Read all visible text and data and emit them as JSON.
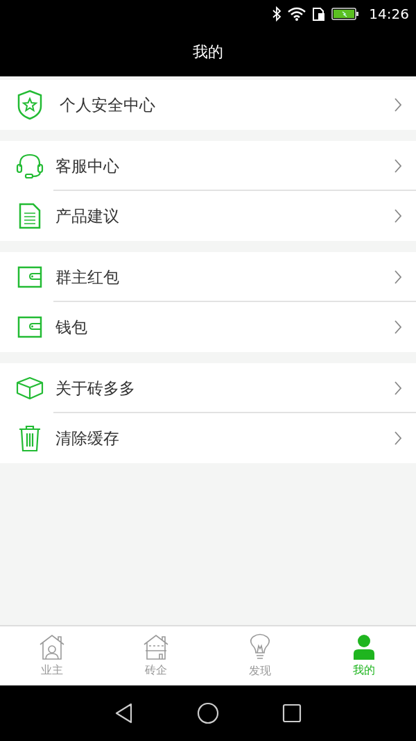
{
  "status_bar": {
    "time": "14:26"
  },
  "header": {
    "title": "我的"
  },
  "groups": [
    {
      "items": [
        {
          "label": "个人安全中心",
          "kind": "shield"
        }
      ]
    },
    {
      "items": [
        {
          "label": "客服中心",
          "kind": "headset"
        },
        {
          "label": "产品建议",
          "kind": "document"
        }
      ]
    },
    {
      "items": [
        {
          "label": "群主红包",
          "kind": "wallet"
        },
        {
          "label": "钱包",
          "kind": "wallet"
        }
      ]
    },
    {
      "items": [
        {
          "label": "关于砖多多",
          "kind": "cube"
        },
        {
          "label": "清除缓存",
          "kind": "trash"
        }
      ]
    }
  ],
  "tabs": [
    {
      "label": "业主",
      "kind": "owner",
      "selected": false
    },
    {
      "label": "砖企",
      "kind": "house",
      "selected": false
    },
    {
      "label": "发现",
      "kind": "bulb",
      "selected": false
    },
    {
      "label": "我的",
      "kind": "person",
      "selected": true
    }
  ]
}
